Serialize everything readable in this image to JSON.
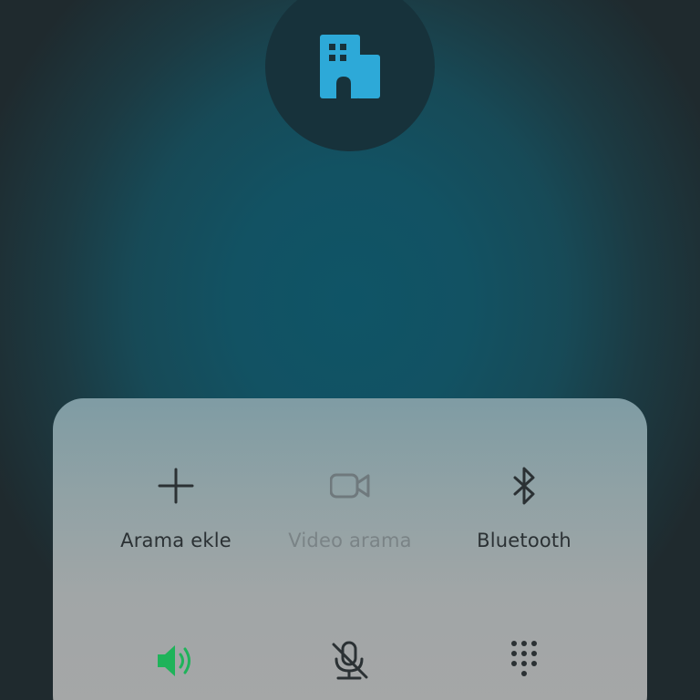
{
  "contact": {
    "avatar_icon": "building-icon",
    "avatar_icon_color": "#2da9d8"
  },
  "controls": {
    "row1": [
      {
        "label": "Arama ekle",
        "icon": "plus-icon",
        "enabled": true
      },
      {
        "label": "Video arama",
        "icon": "video-camera-icon",
        "enabled": false
      },
      {
        "label": "Bluetooth",
        "icon": "bluetooth-icon",
        "enabled": true
      }
    ],
    "row2": [
      {
        "icon": "speaker-icon",
        "active": true,
        "color": "#1fb35a"
      },
      {
        "icon": "microphone-muted-icon",
        "active": false
      },
      {
        "icon": "dialpad-icon",
        "active": false
      }
    ]
  }
}
